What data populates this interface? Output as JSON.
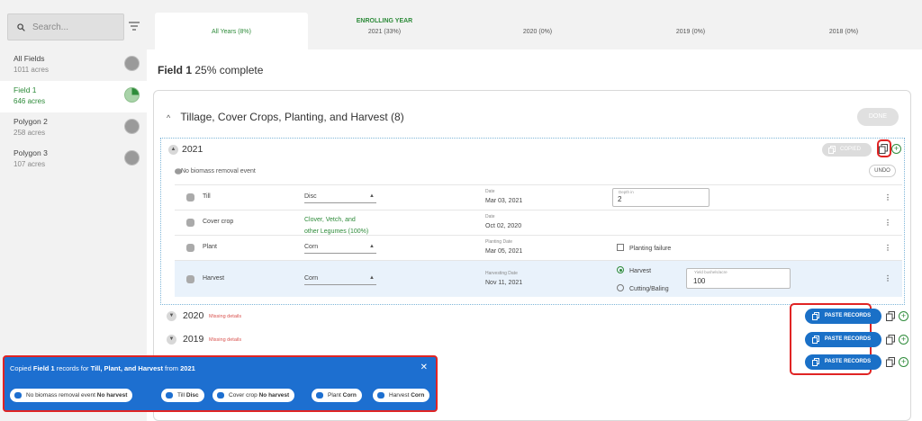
{
  "search": {
    "placeholder": "Search..."
  },
  "sidebar": {
    "items": [
      {
        "name": "All Fields",
        "acres": "1011 acres"
      },
      {
        "name": "Field 1",
        "acres": "646 acres"
      },
      {
        "name": "Polygon 2",
        "acres": "258 acres"
      },
      {
        "name": "Polygon 3",
        "acres": "107 acres"
      }
    ]
  },
  "tabs": [
    {
      "label": "All Years (8%)",
      "sup": ""
    },
    {
      "label": "2021 (33%)",
      "sup": "ENROLLING YEAR"
    },
    {
      "label": "2020 (0%)",
      "sup": ""
    },
    {
      "label": "2019 (0%)",
      "sup": ""
    },
    {
      "label": "2018 (0%)",
      "sup": ""
    }
  ],
  "field": {
    "name": "Field 1",
    "progress": "25% complete"
  },
  "section": {
    "title": "Tillage, Cover Crops, Planting, and Harvest (8)",
    "done_label": "DONE"
  },
  "year2021": {
    "year": "2021",
    "copied_label": "COPIED",
    "no_biomass": "No biomass removal event",
    "undo_label": "UNDO",
    "operations": [
      {
        "name": "Till",
        "value": "Disc",
        "date_label": "Date",
        "date": "Mar 03, 2021",
        "depth_label": "Depth in",
        "depth": "2"
      },
      {
        "name": "Cover crop",
        "value_line1": "Clover, Vetch, and",
        "value_line2": "other Legumes (100%)",
        "date_label": "Date",
        "date": "Oct 02, 2020"
      },
      {
        "name": "Plant",
        "value": "Corn",
        "date_label": "Planting Date",
        "date": "Mar 05, 2021",
        "failure_label": "Planting failure"
      },
      {
        "name": "Harvest",
        "value": "Corn",
        "date_label": "Harvesting Date",
        "date": "Nov 11, 2021",
        "opt1": "Harvest",
        "opt2": "Cutting/Baling",
        "yield_label": "Yield bushels/acre",
        "yield": "100"
      }
    ]
  },
  "other_years": [
    {
      "year": "2020",
      "missing": "Missing details",
      "paste_label": "PASTE RECORDS"
    },
    {
      "year": "2019",
      "missing": "Missing details",
      "paste_label": "PASTE RECORDS"
    },
    {
      "year": "",
      "missing": "",
      "paste_label": "PASTE RECORDS"
    }
  ],
  "toast": {
    "prefix": "Copied ",
    "field": "Field 1",
    "mid": " records for ",
    "ops": "Till, Plant, and Harvest",
    "from": " from ",
    "year": "2021",
    "close": "✕",
    "chips": [
      {
        "label": "No biomass removal event",
        "value": "No harvest"
      },
      {
        "label": "Till",
        "value": "Disc"
      },
      {
        "label": "Cover crop",
        "value": "No harvest"
      },
      {
        "label": "Plant",
        "value": "Corn"
      },
      {
        "label": "Harvest",
        "value": "Corn"
      }
    ]
  },
  "colors": {
    "accent_green": "#2e8b3a",
    "primary_blue": "#1a70c7",
    "highlight_red": "#e02424",
    "missing_red": "#d9534f"
  }
}
